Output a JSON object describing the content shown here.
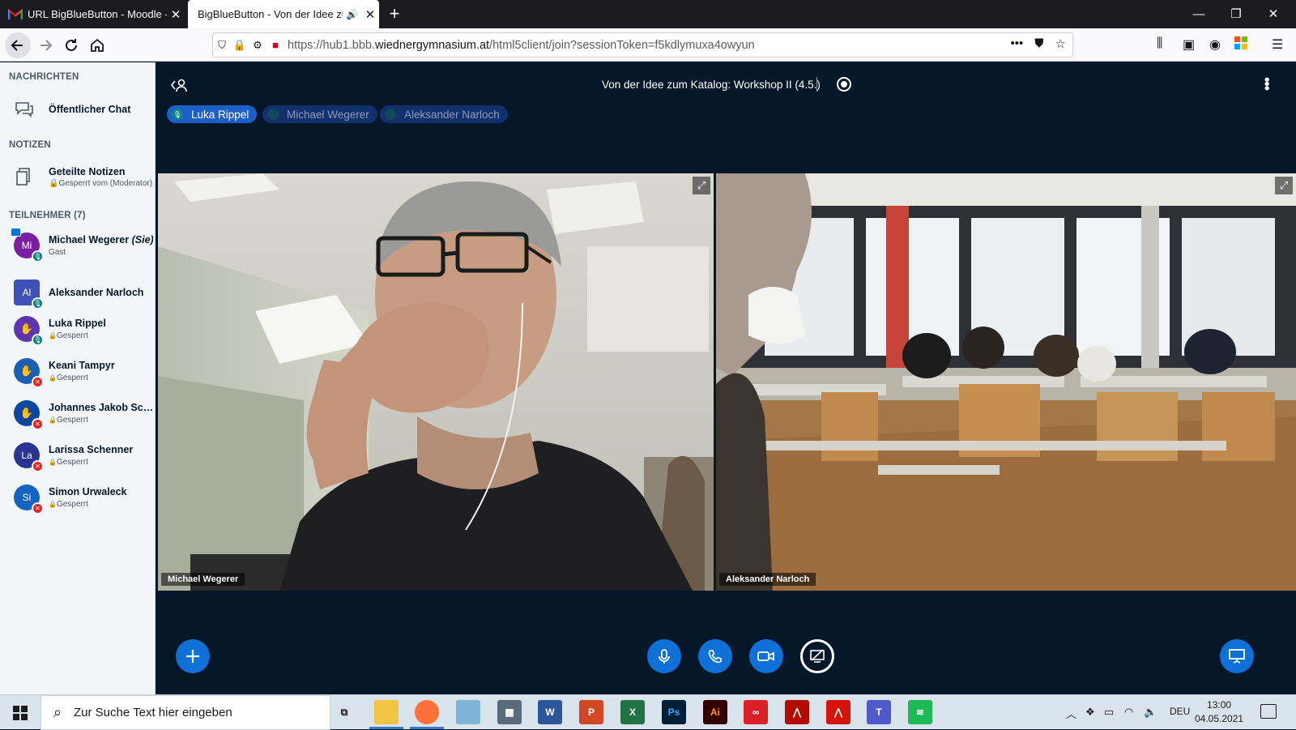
{
  "browser": {
    "tabs": [
      {
        "title": "URL BigBlueButton - Moodle - ",
        "close": "✕"
      },
      {
        "title": "BigBlueButton - Von der Idee zu",
        "close": "✕"
      }
    ],
    "new_tab": "+",
    "window_controls": [
      "—",
      "❐",
      "✕"
    ],
    "url": {
      "prefix": "https://hub1.bbb.",
      "host": "wiednergymnasium.at",
      "path": "/html5client/join?sessionToken=f5kdlymuxa4owyun"
    },
    "url_actions": [
      "•••",
      "pocket-icon",
      "star-icon"
    ]
  },
  "sidebar": {
    "messages_heading": "NACHRICHTEN",
    "public_chat": "Öffentlicher Chat",
    "notes_heading": "NOTIZEN",
    "shared_notes": {
      "label": "Geteilte Notizen",
      "sub": "Gesperrt vom (Moderator)"
    },
    "participants_heading": "TEILNEHMER (7)",
    "participants": [
      {
        "initials": "Mi",
        "name": "Michael Wegerer",
        "suffix": "(Sie)",
        "sub": "Gast",
        "color": "#7b1fa2",
        "status": "ok",
        "presenter": true
      },
      {
        "initials": "Al",
        "name": "Aleksander Narloch",
        "suffix": "",
        "sub": "",
        "color": "#3f51b5",
        "status": "ok",
        "moderator": true
      },
      {
        "initials": "",
        "name": "Luka Rippel",
        "suffix": "",
        "sub": "Gesperrt",
        "color": "#5e35b1",
        "status": "ok",
        "hand": true
      },
      {
        "initials": "",
        "name": "Keani Tampyr",
        "suffix": "",
        "sub": "Gesperrt",
        "color": "#1a5fb4",
        "status": "muted",
        "hand": true
      },
      {
        "initials": "",
        "name": "Johannes Jakob Sch...",
        "suffix": "",
        "sub": "Gesperrt",
        "color": "#0d47a1",
        "status": "muted",
        "hand": true
      },
      {
        "initials": "La",
        "name": "Larissa Schenner",
        "suffix": "",
        "sub": "Gesperrt",
        "color": "#283593",
        "status": "muted"
      },
      {
        "initials": "Si",
        "name": "Simon Urwaleck",
        "suffix": "",
        "sub": "Gesperrt",
        "color": "#1565c0",
        "status": "muted"
      }
    ]
  },
  "meeting": {
    "title": "Von der Idee zum Katalog: Workshop II (4.5.)",
    "talkers": [
      "Luka Rippel",
      "Michael Wegerer",
      "Aleksander Narloch"
    ],
    "videos": [
      {
        "name": "Michael Wegerer"
      },
      {
        "name": "Aleksander Narloch"
      }
    ],
    "controls": [
      "plus-icon",
      "microphone-icon",
      "phone-icon",
      "camera-icon",
      "screen-share-icon",
      "presentation-icon"
    ]
  },
  "taskbar": {
    "search_placeholder": "Zur Suche Text hier eingeben",
    "apps": [
      {
        "name": "task-view",
        "label": ""
      },
      {
        "name": "file-explorer",
        "label": ""
      },
      {
        "name": "firefox",
        "label": ""
      },
      {
        "name": "generic-app",
        "label": ""
      },
      {
        "name": "calculator",
        "label": ""
      },
      {
        "name": "word",
        "label": "W"
      },
      {
        "name": "powerpoint",
        "label": "P"
      },
      {
        "name": "excel",
        "label": "X"
      },
      {
        "name": "photoshop",
        "label": "Ps"
      },
      {
        "name": "illustrator",
        "label": "Ai"
      },
      {
        "name": "creative-cloud",
        "label": ""
      },
      {
        "name": "acrobat",
        "label": ""
      },
      {
        "name": "acrobat-reader",
        "label": ""
      },
      {
        "name": "teams",
        "label": ""
      },
      {
        "name": "spotify",
        "label": ""
      }
    ],
    "language": "DEU",
    "time": "13:00",
    "date": "04.05.2021"
  }
}
